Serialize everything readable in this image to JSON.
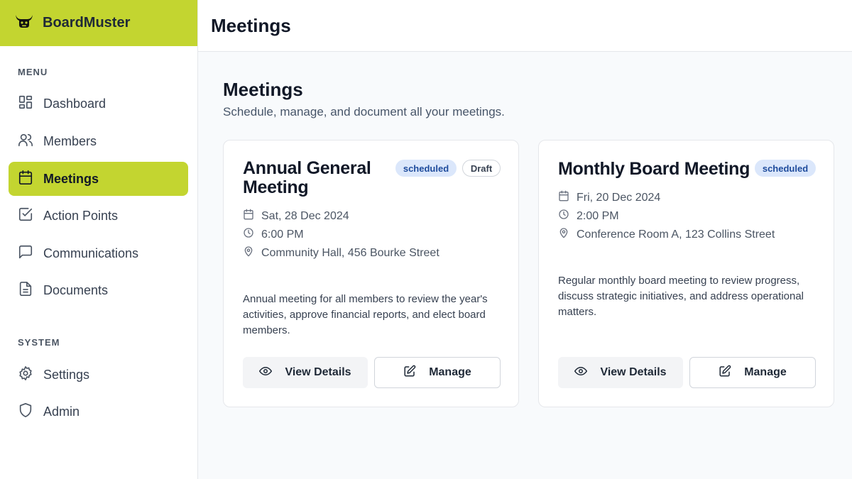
{
  "app": {
    "name": "BoardMuster"
  },
  "sidebar": {
    "menu_label": "MENU",
    "system_label": "SYSTEM",
    "menu_items": [
      {
        "label": "Dashboard",
        "icon": "dashboard-icon"
      },
      {
        "label": "Members",
        "icon": "users-icon"
      },
      {
        "label": "Meetings",
        "icon": "calendar-icon",
        "active": true
      },
      {
        "label": "Action Points",
        "icon": "check-square-icon"
      },
      {
        "label": "Communications",
        "icon": "message-icon"
      },
      {
        "label": "Documents",
        "icon": "document-icon"
      }
    ],
    "system_items": [
      {
        "label": "Settings",
        "icon": "gear-icon"
      },
      {
        "label": "Admin",
        "icon": "shield-icon"
      }
    ]
  },
  "header": {
    "title": "Meetings"
  },
  "main": {
    "title": "Meetings",
    "subtitle": "Schedule, manage, and document all your meetings."
  },
  "meetings": [
    {
      "title_line1": "Annual General",
      "title_line2": "Meeting",
      "status": "scheduled",
      "draft": "Draft",
      "date": "Sat, 28 Dec 2024",
      "time": "6:00 PM",
      "location": "Community Hall, 456 Bourke Street",
      "description": "Annual meeting for all members to review the year's activities, approve financial reports, and elect board members.",
      "view_label": "View Details",
      "manage_label": "Manage"
    },
    {
      "title_line1": "Monthly Board Meeting",
      "status": "scheduled",
      "date": "Fri, 20 Dec 2024",
      "time": "2:00 PM",
      "location": "Conference Room A, 123 Collins Street",
      "description": "Regular monthly board meeting to review progress, discuss strategic initiatives, and address operational matters.",
      "view_label": "View Details",
      "manage_label": "Manage"
    }
  ],
  "colors": {
    "accent": "#c3d530",
    "badge_scheduled_bg": "#dbe7fb",
    "badge_scheduled_text": "#1e4b9c"
  }
}
